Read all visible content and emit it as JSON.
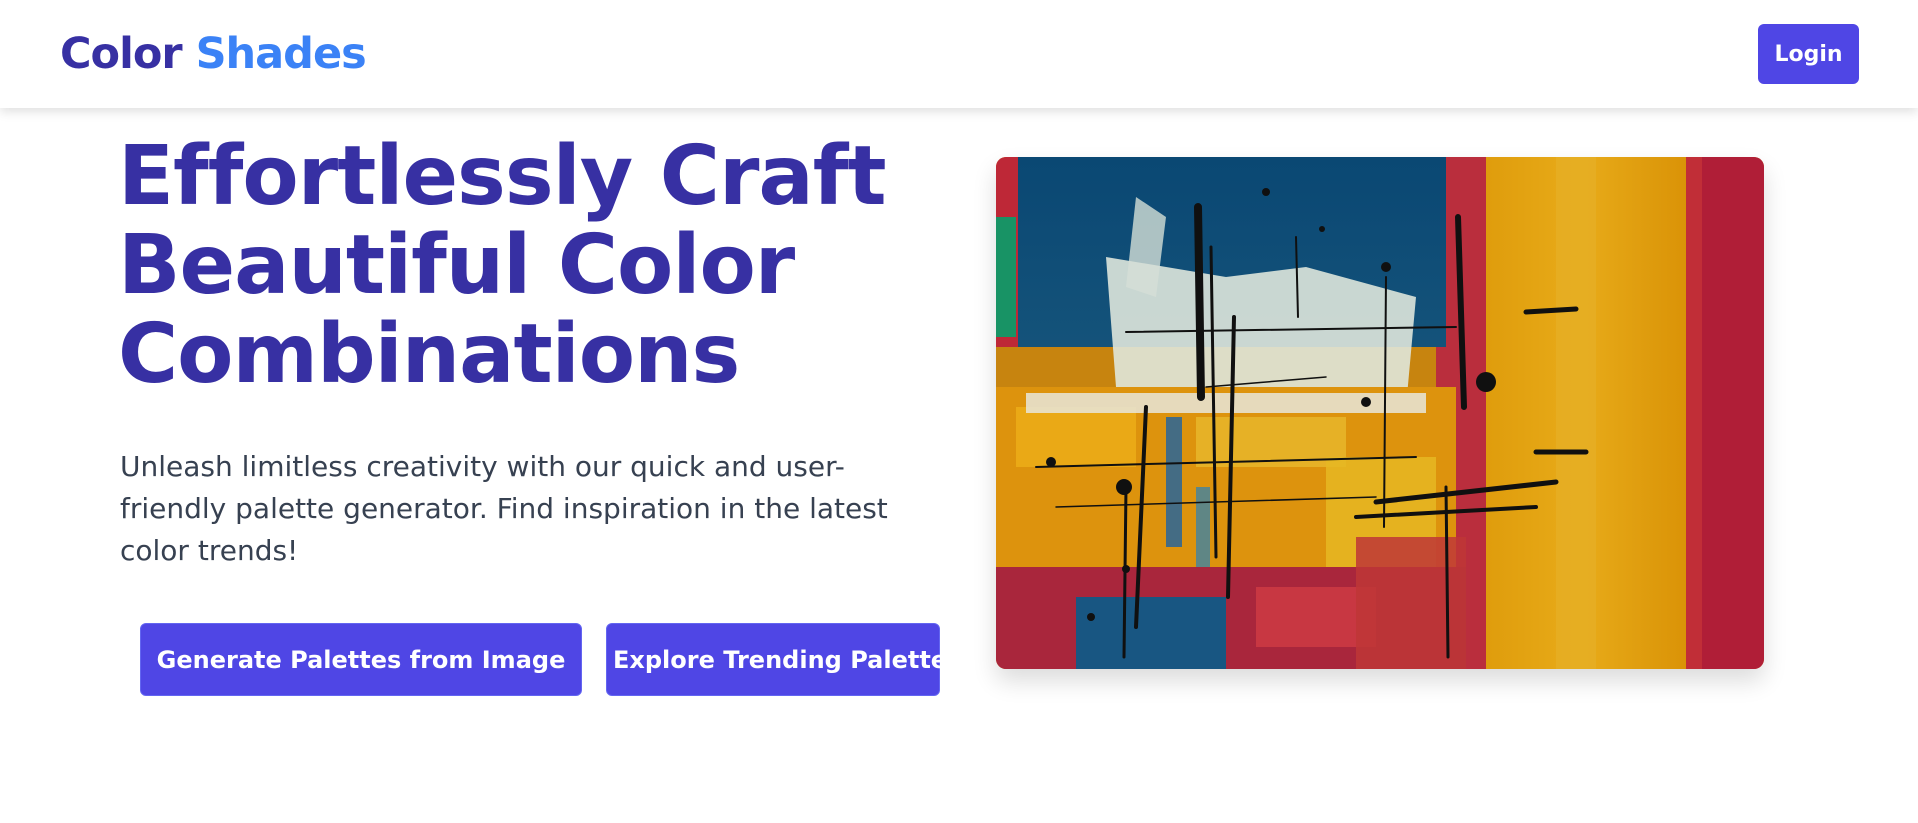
{
  "header": {
    "logo": {
      "word1": "Color",
      "word2": "Shades"
    },
    "login_label": "Login"
  },
  "hero": {
    "title_lines": [
      "Effortlessly Craft",
      "Beautiful Color",
      "Combinations"
    ],
    "description_lines": [
      "Unleash limitless creativity with our quick and user-",
      "friendly palette generator. Find inspiration in the latest",
      "color trends!"
    ],
    "buttons": {
      "generate": "Generate Palettes from Image",
      "explore": "Explore Trending Palettes"
    },
    "image_alt": "abstract painting"
  },
  "colors": {
    "brand_dark": "#3730a3",
    "brand_light": "#3b82f6",
    "button": "#4f46e5",
    "text": "#374151"
  }
}
